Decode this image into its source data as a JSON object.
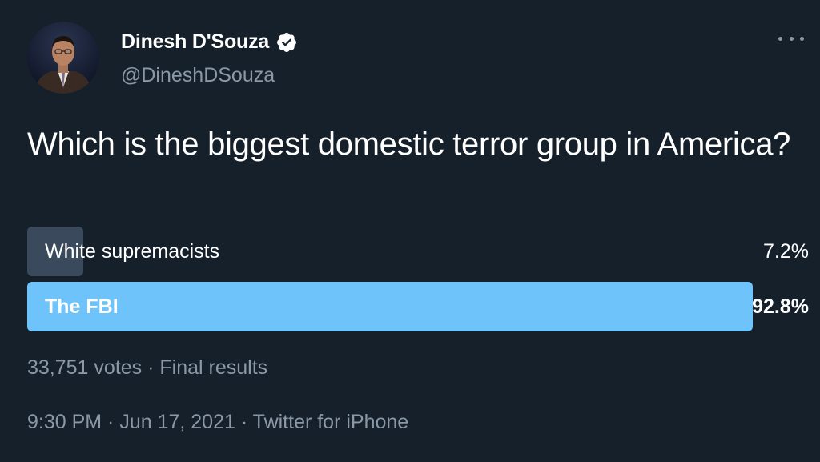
{
  "author": {
    "display_name": "Dinesh D'Souza",
    "handle": "@DineshDSouza",
    "verified": true
  },
  "tweet": {
    "text": "Which is the biggest domestic terror group in America?"
  },
  "poll": {
    "options": [
      {
        "label": "White supremacists",
        "percent_text": "7.2%",
        "percent": 7.2,
        "winner": false
      },
      {
        "label": "The FBI",
        "percent_text": "92.8%",
        "percent": 92.8,
        "winner": true
      }
    ],
    "votes": "33,751 votes",
    "status": "Final results",
    "separator": " · "
  },
  "meta": {
    "time": "9:30 PM",
    "date": "Jun 17, 2021",
    "source": "Twitter for iPhone",
    "separator": " · "
  },
  "icons": {
    "verified": "verified-badge-icon",
    "more": "more-options-icon"
  },
  "colors": {
    "background": "#15202b",
    "winner_bar": "#6ec3fb",
    "loser_bar": "#3a4a5c",
    "secondary_text": "#8b98a5"
  }
}
